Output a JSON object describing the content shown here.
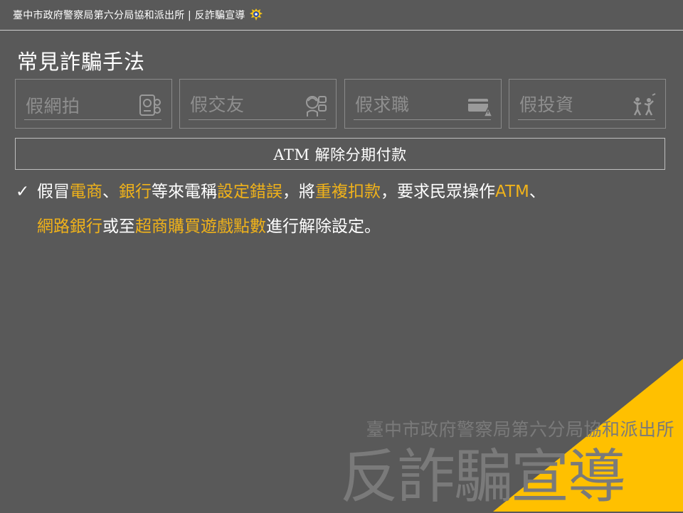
{
  "header": {
    "text": "臺中市政府警察局第六分局協和派出所 | 反詐騙宣導",
    "badge_icon": "police-badge-icon"
  },
  "page_title": "常見詐騙手法",
  "tabs": [
    {
      "label": "假網拍",
      "icon": "phone-shopping-icon"
    },
    {
      "label": "假交友",
      "icon": "chat-person-icon"
    },
    {
      "label": "假求職",
      "icon": "warning-card-icon"
    },
    {
      "label": "假投資",
      "icon": "people-money-icon"
    }
  ],
  "section_title": "ATM 解除分期付款",
  "description": {
    "check_mark": "✓",
    "segments_line1": [
      {
        "text": "假冒",
        "highlight": false
      },
      {
        "text": "電商",
        "highlight": true
      },
      {
        "text": "、",
        "highlight": false
      },
      {
        "text": "銀行",
        "highlight": true
      },
      {
        "text": "等來電稱",
        "highlight": false
      },
      {
        "text": "設定錯誤",
        "highlight": true
      },
      {
        "text": "，將",
        "highlight": false
      },
      {
        "text": "重複扣款",
        "highlight": true
      },
      {
        "text": "，要求民眾操作",
        "highlight": false
      },
      {
        "text": "ATM",
        "highlight": true
      },
      {
        "text": "、",
        "highlight": false
      }
    ],
    "segments_line2": [
      {
        "text": "網路銀行",
        "highlight": true
      },
      {
        "text": "或至",
        "highlight": false
      },
      {
        "text": "超商購買遊戲點數",
        "highlight": true
      },
      {
        "text": "進行解除設定。",
        "highlight": false
      }
    ]
  },
  "watermark": {
    "line1": "臺中市政府警察局第六分局協和派出所",
    "line2": "反詐騙宣導"
  },
  "colors": {
    "background": "#595959",
    "highlight": "#f0b21a",
    "corner_accent": "#ffc000"
  }
}
